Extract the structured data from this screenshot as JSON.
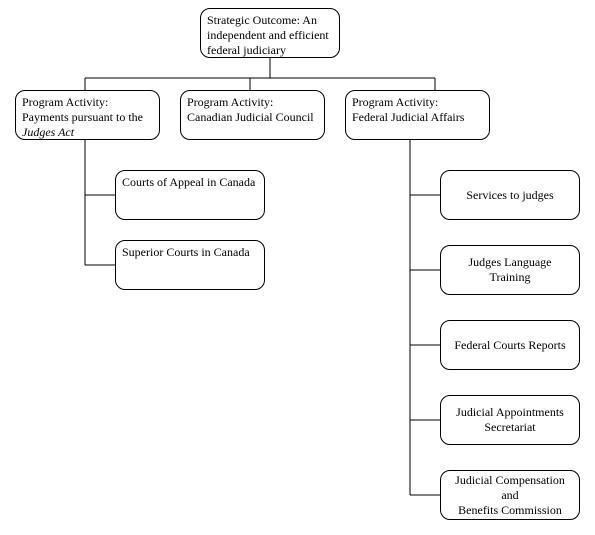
{
  "root": {
    "line1": "Strategic Outcome: An",
    "line2": "independent and efficient",
    "line3": "federal judiciary"
  },
  "programs": {
    "payments": {
      "line1": "Program Activity:",
      "line2": "Payments pursuant to the",
      "line3": "Judges Act"
    },
    "council": {
      "line1": "Program Activity:",
      "line2": "Canadian Judicial Council"
    },
    "federal": {
      "line1": "Program Activity:",
      "line2": "Federal Judicial Affairs"
    }
  },
  "payments_children": {
    "appeal": "Courts of Appeal in Canada",
    "superior": "Superior Courts in Canada"
  },
  "federal_children": {
    "services": "Services to judges",
    "language": "Judges Language Training",
    "reports": "Federal Courts Reports",
    "appointments_l1": "Judicial Appointments",
    "appointments_l2": "Secretariat",
    "compensation_l1": "Judicial Compensation and",
    "compensation_l2": "Benefits Commission"
  }
}
